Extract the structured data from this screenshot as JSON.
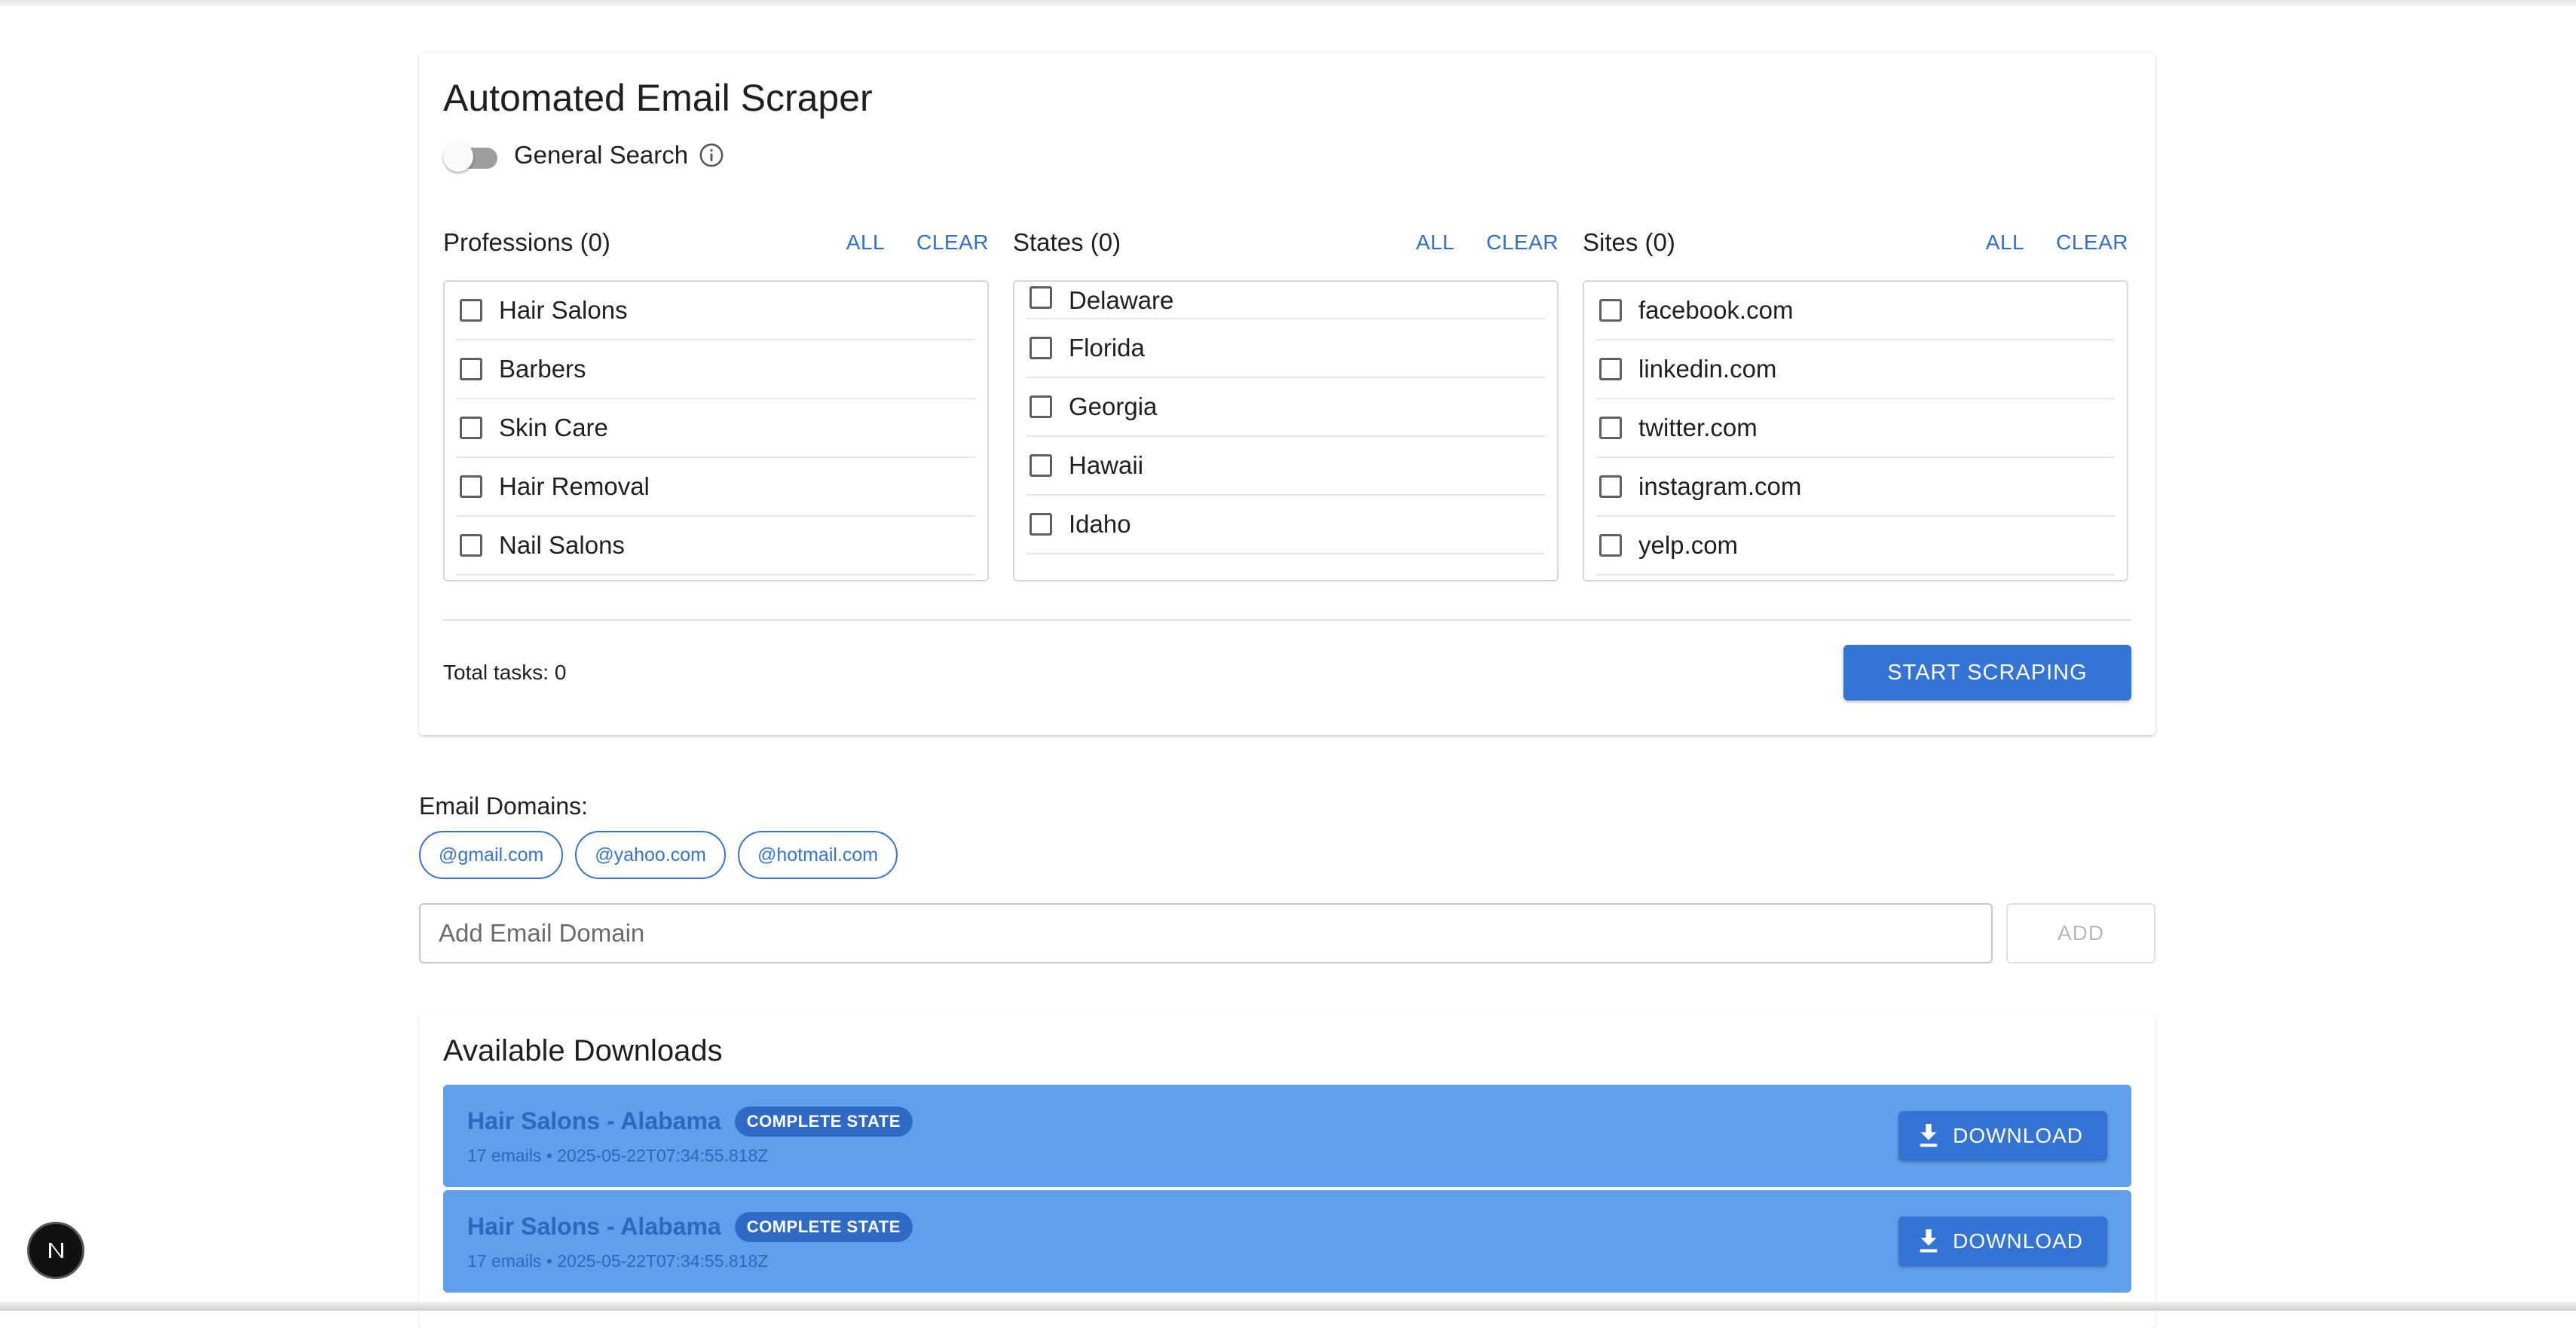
{
  "scraper": {
    "title": "Automated Email Scraper",
    "general_search_label": "General Search",
    "general_search_on": false,
    "columns": [
      {
        "title": "Professions (0)",
        "all_label": "ALL",
        "clear_label": "CLEAR",
        "items": [
          "Hair Salons",
          "Barbers",
          "Skin Care",
          "Hair Removal",
          "Nail Salons"
        ]
      },
      {
        "title": "States (0)",
        "all_label": "ALL",
        "clear_label": "CLEAR",
        "items": [
          "Delaware",
          "Florida",
          "Georgia",
          "Hawaii",
          "Idaho"
        ]
      },
      {
        "title": "Sites (0)",
        "all_label": "ALL",
        "clear_label": "CLEAR",
        "items": [
          "facebook.com",
          "linkedin.com",
          "twitter.com",
          "instagram.com",
          "yelp.com"
        ]
      }
    ],
    "total_tasks": "Total tasks: 0",
    "start_label": "START SCRAPING"
  },
  "domains": {
    "title": "Email Domains:",
    "chips": [
      "@gmail.com",
      "@yahoo.com",
      "@hotmail.com"
    ],
    "input_placeholder": "Add Email Domain",
    "add_label": "ADD"
  },
  "downloads": {
    "title": "Available Downloads",
    "items": [
      {
        "name": "Hair Salons - Alabama",
        "badge": "COMPLETE STATE",
        "meta": "17 emails • 2025-05-22T07:34:55.818Z",
        "button": "DOWNLOAD"
      },
      {
        "name": "Hair Salons - Alabama",
        "badge": "COMPLETE STATE",
        "meta": "17 emails • 2025-05-22T07:34:55.818Z",
        "button": "DOWNLOAD"
      }
    ]
  },
  "colors": {
    "primary": "#3474d4",
    "download_row": "#5fa0ea"
  },
  "icons": [
    "info-icon",
    "download-icon",
    "next-logo-icon"
  ]
}
